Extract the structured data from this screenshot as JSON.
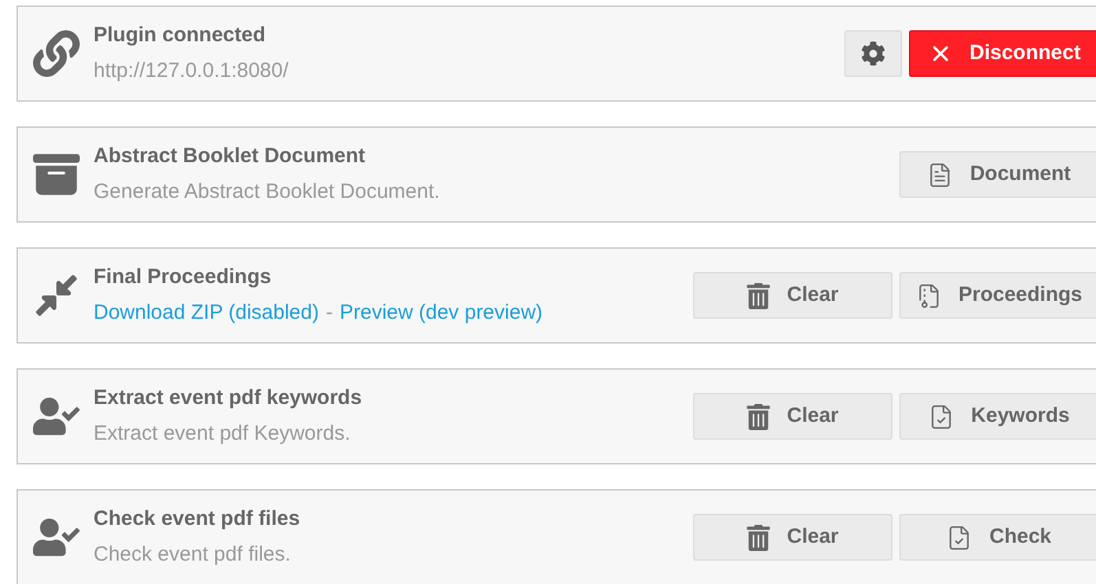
{
  "cards": [
    {
      "kind": "connection",
      "title": "Plugin connected",
      "subtitle": [
        {
          "kind": "text",
          "text": "http://127.0.0.1:8080/"
        }
      ],
      "buttons": [
        {
          "kind": "settings"
        },
        {
          "kind": "disconnect",
          "label": "Disconnect"
        }
      ]
    },
    {
      "kind": "booklet",
      "title": "Abstract Booklet Document",
      "subtitle": [
        {
          "kind": "text",
          "text": "Generate Abstract Booklet Document."
        }
      ],
      "buttons": [
        {
          "kind": "document",
          "label": "Document"
        }
      ]
    },
    {
      "kind": "proceedings",
      "title": "Final Proceedings",
      "subtitle": [
        {
          "kind": "link",
          "text": "Download ZIP (disabled)"
        },
        {
          "kind": "separator",
          "text": "-"
        },
        {
          "kind": "link",
          "text": "Preview (dev preview)"
        }
      ],
      "buttons": [
        {
          "kind": "clear",
          "label": "Clear"
        },
        {
          "kind": "archive",
          "label": "Proceedings"
        }
      ]
    },
    {
      "kind": "task",
      "title": "Extract event pdf keywords",
      "subtitle": [
        {
          "kind": "text",
          "text": "Extract event pdf Keywords."
        }
      ],
      "buttons": [
        {
          "kind": "clear",
          "label": "Clear"
        },
        {
          "kind": "check",
          "label": "Keywords"
        }
      ]
    },
    {
      "kind": "task",
      "title": "Check event pdf files",
      "subtitle": [
        {
          "kind": "text",
          "text": "Check event pdf files."
        }
      ],
      "buttons": [
        {
          "kind": "clear",
          "label": "Clear"
        },
        {
          "kind": "check",
          "label": "Check"
        }
      ]
    }
  ]
}
